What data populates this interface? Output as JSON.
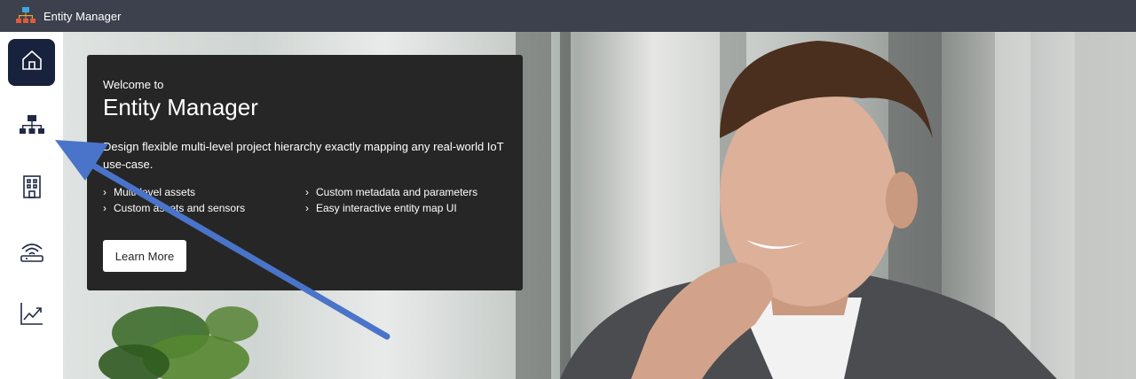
{
  "app": {
    "title": "Entity Manager",
    "logo_icon": "hierarchy-icon"
  },
  "sidebar": {
    "items": [
      {
        "name": "home",
        "icon": "home-icon",
        "active": true
      },
      {
        "name": "entity-manager",
        "icon": "hierarchy-icon",
        "active": false
      },
      {
        "name": "buildings",
        "icon": "building-icon",
        "active": false
      },
      {
        "name": "devices",
        "icon": "router-icon",
        "active": false
      },
      {
        "name": "analytics",
        "icon": "chart-icon",
        "active": false
      }
    ]
  },
  "welcome_card": {
    "welcome": "Welcome to",
    "heading": "Entity Manager",
    "description": "Design flexible multi-level project hierarchy exactly mapping any real-world IoT use-case.",
    "features_left": [
      "Multi-level assets",
      "Custom assets and sensors"
    ],
    "features_right": [
      "Custom metadata and parameters",
      "Easy interactive entity map UI"
    ],
    "button": "Learn More"
  },
  "colors": {
    "topbar": "#3c414d",
    "active_nav": "#18223c",
    "card": "#262626",
    "annotation_arrow": "#4a74c9"
  }
}
